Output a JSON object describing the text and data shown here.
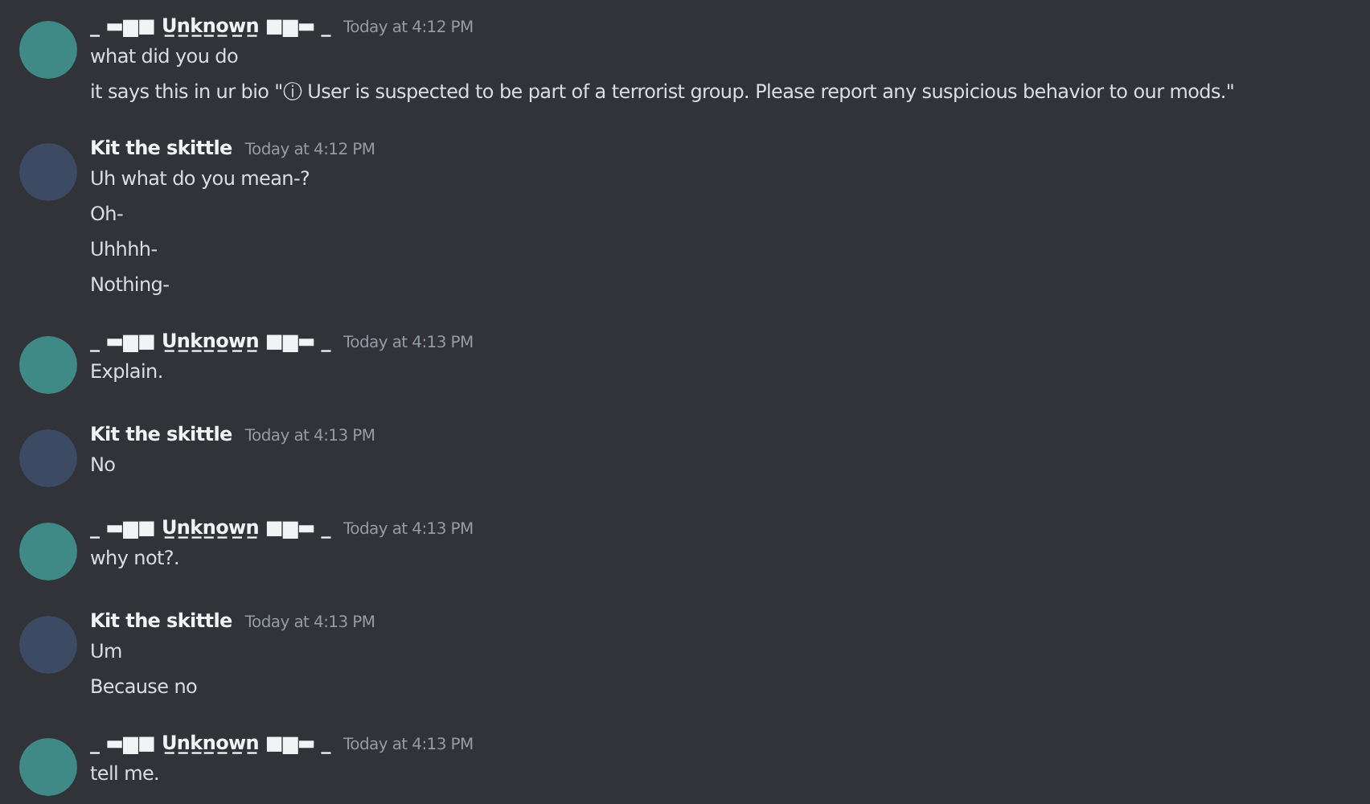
{
  "messages": [
    {
      "author": "_ ▬▆■ U̲n̲k̲n̲o̲w̲n̲ ■▆▬ _",
      "color": "#3f8a86",
      "time": "Today at 4:12 PM",
      "lines": [
        "what did you do",
        "it says this in ur bio  \"ⓘ User is suspected to be part of a terrorist group. Please report any suspicious behavior to our mods.\""
      ]
    },
    {
      "author": "Kit the skittle",
      "color": "#3c4a63",
      "time": "Today at 4:12 PM",
      "lines": [
        "Uh what do you mean-?",
        "Oh-",
        "Uhhhh-",
        "Nothing-"
      ]
    },
    {
      "author": "_ ▬▆■ U̲n̲k̲n̲o̲w̲n̲ ■▆▬ _",
      "color": "#3f8a86",
      "time": "Today at 4:13 PM",
      "lines": [
        "Explain."
      ]
    },
    {
      "author": "Kit the skittle",
      "color": "#3c4a63",
      "time": "Today at 4:13 PM",
      "lines": [
        "No"
      ]
    },
    {
      "author": "_ ▬▆■ U̲n̲k̲n̲o̲w̲n̲ ■▆▬ _",
      "color": "#3f8a86",
      "time": "Today at 4:13 PM",
      "lines": [
        "why not?."
      ]
    },
    {
      "author": "Kit the skittle",
      "color": "#3c4a63",
      "time": "Today at 4:13 PM",
      "lines": [
        "Um",
        "Because no"
      ]
    },
    {
      "author": "_ ▬▆■ U̲n̲k̲n̲o̲w̲n̲ ■▆▬ _",
      "color": "#3f8a86",
      "time": "Today at 4:13 PM",
      "lines": [
        "tell me."
      ]
    }
  ]
}
